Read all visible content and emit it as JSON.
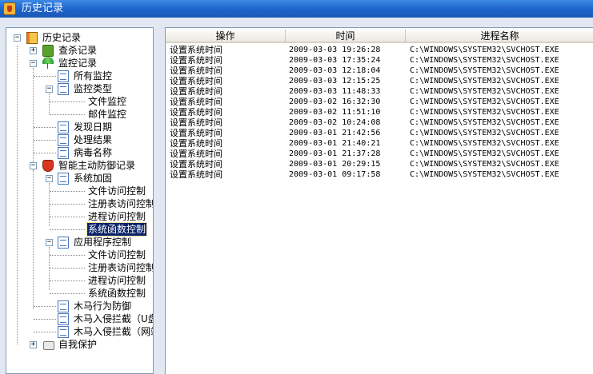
{
  "window": {
    "title": "历史记录"
  },
  "tree": {
    "root": "历史记录",
    "items": [
      "查杀记录",
      "监控记录",
      "所有监控",
      "监控类型",
      "文件监控",
      "邮件监控",
      "发现日期",
      "处理结果",
      "病毒名称",
      "智能主动防御记录",
      "系统加固",
      "文件访问控制",
      "注册表访问控制",
      "进程访问控制",
      "系统函数控制",
      "应用程序控制",
      "文件访问控制",
      "注册表访问控制",
      "进程访问控制",
      "系统函数控制",
      "木马行为防御",
      "木马入侵拦截（U盘",
      "木马入侵拦截（网站",
      "自我保护"
    ],
    "selected": "系统函数控制"
  },
  "table": {
    "columns": [
      "操作",
      "时间",
      "进程名称"
    ],
    "rows": [
      [
        "设置系统时间",
        "2009-03-03 19:26:28",
        "C:\\WINDOWS\\SYSTEM32\\SVCHOST.EXE"
      ],
      [
        "设置系统时间",
        "2009-03-03 17:35:24",
        "C:\\WINDOWS\\SYSTEM32\\SVCHOST.EXE"
      ],
      [
        "设置系统时间",
        "2009-03-03 12:18:04",
        "C:\\WINDOWS\\SYSTEM32\\SVCHOST.EXE"
      ],
      [
        "设置系统时间",
        "2009-03-03 12:15:25",
        "C:\\WINDOWS\\SYSTEM32\\SVCHOST.EXE"
      ],
      [
        "设置系统时间",
        "2009-03-03 11:48:33",
        "C:\\WINDOWS\\SYSTEM32\\SVCHOST.EXE"
      ],
      [
        "设置系统时间",
        "2009-03-02 16:32:30",
        "C:\\WINDOWS\\SYSTEM32\\SVCHOST.EXE"
      ],
      [
        "设置系统时间",
        "2009-03-02 11:51:10",
        "C:\\WINDOWS\\SYSTEM32\\SVCHOST.EXE"
      ],
      [
        "设置系统时间",
        "2009-03-02 10:24:08",
        "C:\\WINDOWS\\SYSTEM32\\SVCHOST.EXE"
      ],
      [
        "设置系统时间",
        "2009-03-01 21:42:56",
        "C:\\WINDOWS\\SYSTEM32\\SVCHOST.EXE"
      ],
      [
        "设置系统时间",
        "2009-03-01 21:40:21",
        "C:\\WINDOWS\\SYSTEM32\\SVCHOST.EXE"
      ],
      [
        "设置系统时间",
        "2009-03-01 21:37:28",
        "C:\\WINDOWS\\SYSTEM32\\SVCHOST.EXE"
      ],
      [
        "设置系统时间",
        "2009-03-01 20:29:15",
        "C:\\WINDOWS\\SYSTEM32\\SVCHOST.EXE"
      ],
      [
        "设置系统时间",
        "2009-03-01 09:17:58",
        "C:\\WINDOWS\\SYSTEM32\\SVCHOST.EXE"
      ]
    ]
  }
}
